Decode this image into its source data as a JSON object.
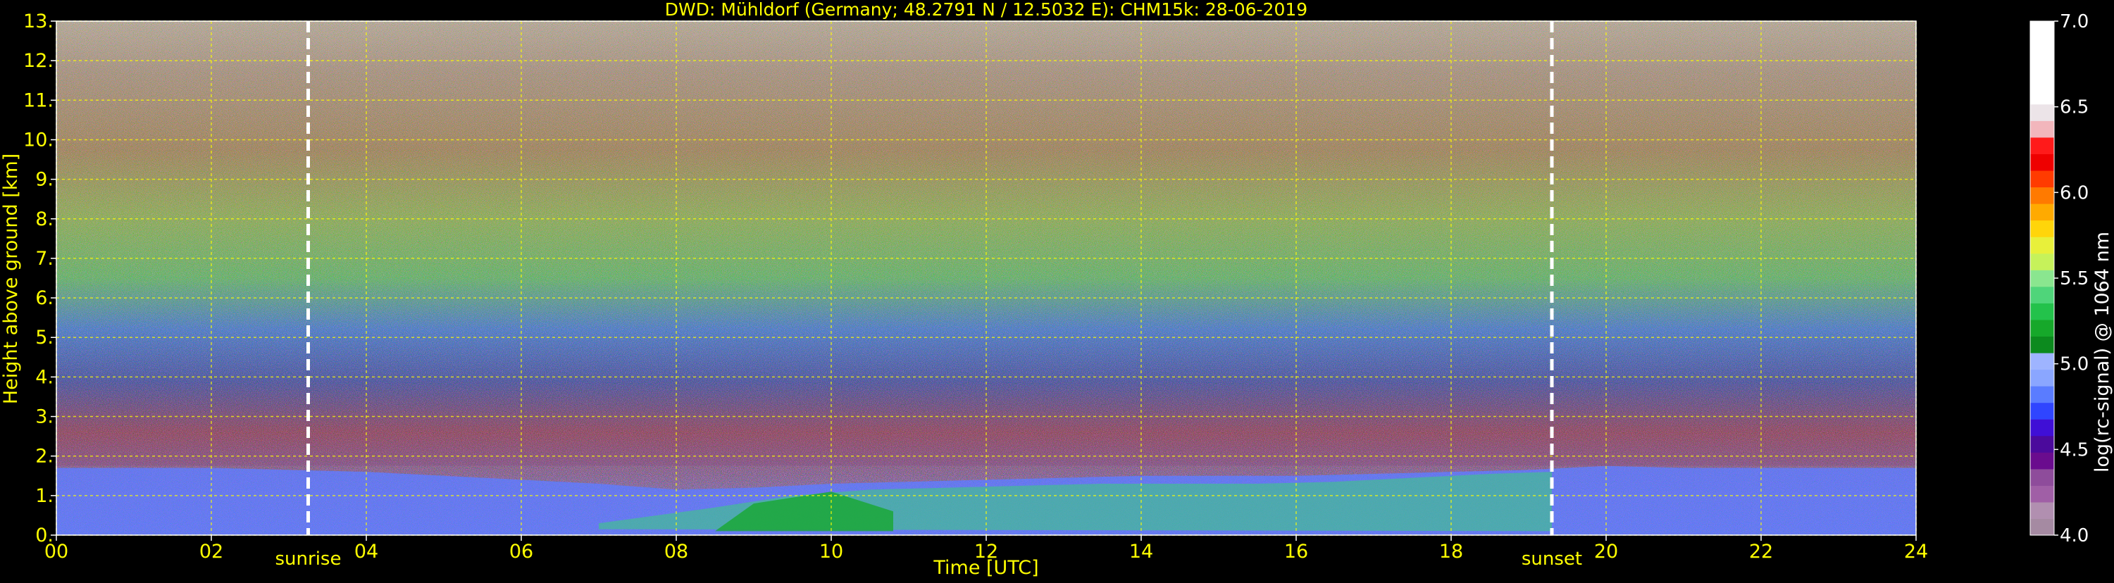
{
  "chart_data": {
    "type": "heatmap",
    "title": "DWD: Mühldorf (Germany; 48.2791 N / 12.5032 E):    CHM15k: 28-06-2019",
    "xlabel": "Time [UTC]",
    "ylabel": "Height above ground [km]",
    "xlim": [
      0,
      24
    ],
    "ylim": [
      0,
      13
    ],
    "xticks": [
      0,
      2,
      4,
      6,
      8,
      10,
      12,
      14,
      16,
      18,
      20,
      22,
      24
    ],
    "xtick_labels": [
      "00",
      "02",
      "04",
      "06",
      "08",
      "10",
      "12",
      "14",
      "16",
      "18",
      "20",
      "22",
      "24"
    ],
    "yticks": [
      0,
      1,
      2,
      3,
      4,
      5,
      6,
      7,
      8,
      9,
      10,
      11,
      12,
      13
    ],
    "ytick_labels": [
      "0.",
      "1.",
      "2.",
      "3.",
      "4.",
      "5.",
      "6.",
      "7.",
      "8.",
      "9.",
      "10.",
      "11.",
      "12.",
      "13."
    ],
    "grid": true,
    "markers": [
      {
        "label": "sunrise",
        "x": 3.25
      },
      {
        "label": "sunset",
        "x": 19.3
      }
    ],
    "colorbar": {
      "label": "log(rc-signal) @ 1064 nm",
      "range": [
        4.0,
        7.0
      ],
      "ticks": [
        4.0,
        4.5,
        5.0,
        5.5,
        6.0,
        6.5,
        7.0
      ],
      "tick_labels": [
        "4.0",
        "4.5",
        "5.0",
        "5.5",
        "6.0",
        "6.5",
        "7.0"
      ],
      "colors": [
        "#a58aa2",
        "#b18fb0",
        "#a05fa6",
        "#8e4c9b",
        "#6a0c8e",
        "#4b0a9c",
        "#3f0fd6",
        "#2f45ff",
        "#5a7cff",
        "#8aa6ff",
        "#9eb4ff",
        "#0c8a1e",
        "#16a82a",
        "#23c24b",
        "#4fd57a",
        "#8ae68f",
        "#c6f25a",
        "#e8f03a",
        "#ffd50a",
        "#ffaa00",
        "#ff7a00",
        "#ff3b00",
        "#ee0000",
        "#ff1a1a",
        "#f2b6bc",
        "#ece4e8",
        "#ffffff",
        "#ffffff",
        "#ffffff",
        "#ffffff",
        "#ffffff"
      ]
    },
    "boundary_layer_top_km": {
      "x": [
        0,
        1,
        2,
        3,
        4,
        5,
        6,
        7,
        8,
        9,
        10,
        11,
        12,
        13,
        14,
        15,
        16,
        17,
        18,
        19,
        20,
        21,
        22,
        23,
        24
      ],
      "values": [
        1.7,
        1.7,
        1.7,
        1.65,
        1.6,
        1.5,
        1.4,
        1.3,
        1.15,
        1.2,
        1.3,
        1.35,
        1.4,
        1.45,
        1.5,
        1.5,
        1.5,
        1.55,
        1.6,
        1.65,
        1.75,
        1.7,
        1.7,
        1.7,
        1.7
      ]
    }
  }
}
